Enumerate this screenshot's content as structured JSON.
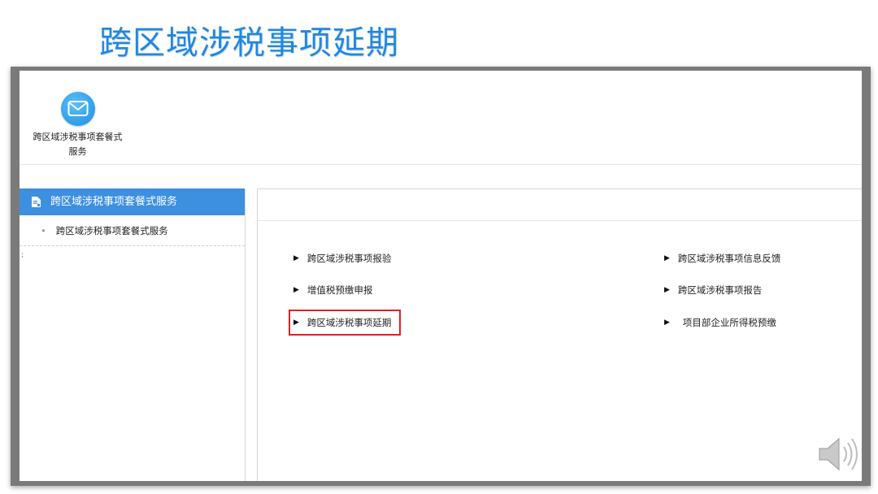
{
  "slide": {
    "title": "跨区域涉税事项延期"
  },
  "app": {
    "tile_label_line1": "跨区域涉税事项套餐式",
    "tile_label_line2": "服务",
    "icon": "mail-icon"
  },
  "sidebar": {
    "header": "跨区域涉税事项套餐式服务",
    "items": [
      {
        "label": "跨区域涉税事项套餐式服务"
      }
    ],
    "accent_color": "#3d8fe0"
  },
  "main": {
    "links": [
      {
        "label": "跨区域涉税事项报验"
      },
      {
        "label": "增值税预缴申报"
      },
      {
        "label": "跨区域涉税事项延期",
        "highlighted": true
      },
      {
        "label": "跨区域涉税事项信息反馈"
      },
      {
        "label": "跨区域涉税事项报告"
      },
      {
        "label": "项目部企业所得税预缴"
      }
    ],
    "arrow_glyph": "▶",
    "highlight_color": "#e02020"
  },
  "misc": {
    "tick": ";"
  }
}
